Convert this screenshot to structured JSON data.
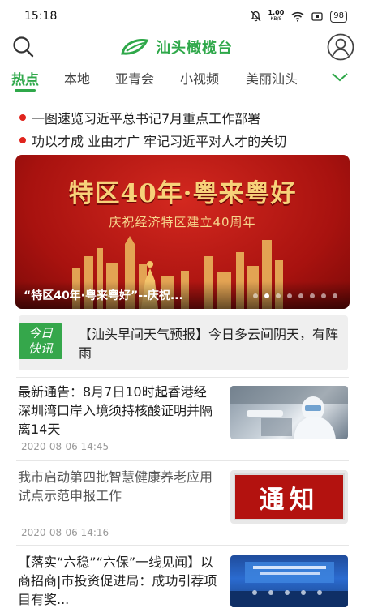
{
  "status_bar": {
    "time": "15:18",
    "net_speed_value": "1.00",
    "net_speed_unit": "KB/S",
    "battery": "98"
  },
  "header": {
    "brand": "汕头橄榄台"
  },
  "tabs": [
    "热点",
    "本地",
    "亚青会",
    "小视频",
    "美丽汕头"
  ],
  "headlines": [
    "一图速览习近平总书记7月重点工作部署",
    "功以才成 业由才广 牢记习近平对人才的关切"
  ],
  "banner": {
    "title": "特区40年·粤来粤好",
    "subtitle": "庆祝经济特区建立40周年",
    "caption": "“特区40年·粤来粤好”--庆祝...",
    "dot_count": 8,
    "active_dot": 1
  },
  "flash": {
    "badge_line1": "今日",
    "badge_line2": "快讯",
    "text": "【汕头早间天气预报】今日多云间阴天，有阵雨"
  },
  "news": [
    {
      "title": "最新通告：8月7日10时起香港经深圳湾口岸入境须持核酸证明并隔离14天",
      "date": "2020-08-06 14:45",
      "thumb": "covid-testing-photo"
    },
    {
      "title": "我市启动第四批智慧健康养老应用试点示范申报工作",
      "date": "2020-08-06 14:16",
      "thumb": "notice-image",
      "thumb_text": "通知"
    },
    {
      "title": "【落实“六稳”“六保”一线见闻】以商招商|市投资促进局：成功引荐项目有奖...",
      "date": "",
      "thumb": "meeting-photo"
    }
  ],
  "colors": {
    "brand_green": "#2fa84a",
    "headline_dot": "#e0241d",
    "banner_red": "#c01a15",
    "banner_gold": "#f7d27a"
  }
}
